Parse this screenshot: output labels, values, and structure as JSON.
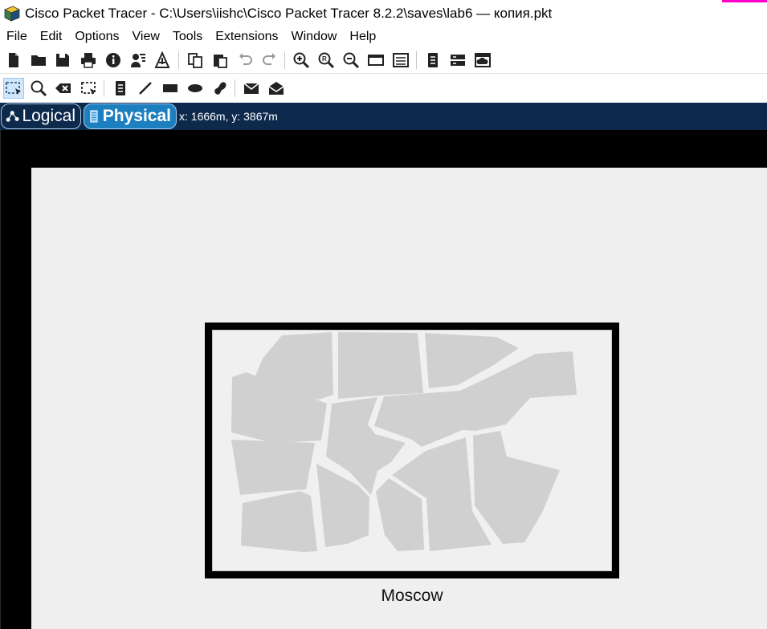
{
  "window": {
    "title": "Cisco Packet Tracer - C:\\Users\\iishc\\Cisco Packet Tracer 8.2.2\\saves\\lab6 — копия.pkt",
    "accent_color": "#ff00c8"
  },
  "menu": {
    "items": [
      "File",
      "Edit",
      "Options",
      "View",
      "Tools",
      "Extensions",
      "Window",
      "Help"
    ]
  },
  "toolbar_main": {
    "icons": [
      "new-file-icon",
      "open-folder-icon",
      "save-icon",
      "print-icon",
      "info-icon",
      "activity-wizard-icon",
      "network-info-icon",
      "copy-icon",
      "paste-icon",
      "undo-icon",
      "redo-icon",
      "zoom-in-icon",
      "zoom-reset-icon",
      "zoom-out-icon",
      "drawing-palette-icon",
      "custom-device-dialog-icon",
      "pdu-list-icon",
      "device-template-icon",
      "cloud-network-icon"
    ]
  },
  "toolbar_draw": {
    "icons": [
      "select-icon",
      "inspect-icon",
      "delete-icon",
      "resize-shape-icon",
      "place-note-icon",
      "draw-line-icon",
      "draw-rectangle-icon",
      "draw-ellipse-icon",
      "draw-freeform-icon",
      "add-simple-pdu-icon",
      "add-complex-pdu-icon"
    ],
    "selected": "select-icon"
  },
  "modebar": {
    "logical_label": "Logical",
    "physical_label": "Physical",
    "active": "Physical",
    "coordinates": "x: 1666m, y: 3867m",
    "bar_color": "#0d2a4d",
    "active_color": "#1e7fc0"
  },
  "workspace": {
    "city_label": "Moscow"
  }
}
